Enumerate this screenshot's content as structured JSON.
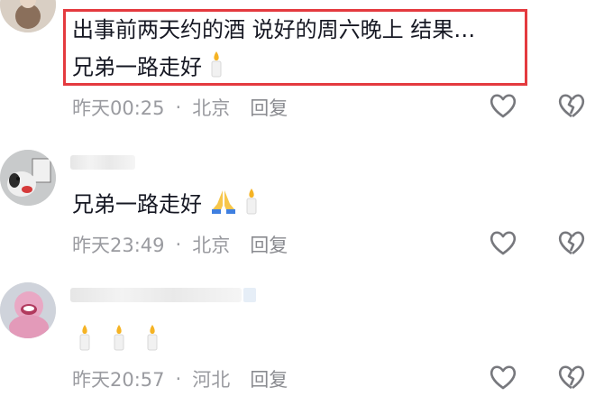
{
  "comments": [
    {
      "text_line1": "出事前两天约的酒 说好的周六晚上 结果…",
      "text_line2": "兄弟一路走好",
      "time": "昨天00:25",
      "location": "北京",
      "reply_label": "回复"
    },
    {
      "text": "兄弟一路走好",
      "time": "昨天23:49",
      "location": "北京",
      "reply_label": "回复"
    },
    {
      "time": "昨天20:57",
      "location": "河北",
      "reply_label": "回复"
    }
  ],
  "separator": "·",
  "icons": {
    "like": "heart-outline-icon",
    "dislike": "broken-heart-icon",
    "candle": "candle-emoji",
    "pray": "folded-hands-emoji"
  },
  "colors": {
    "highlight_border": "#e43a3f",
    "meta_text": "#9a9ba0"
  }
}
